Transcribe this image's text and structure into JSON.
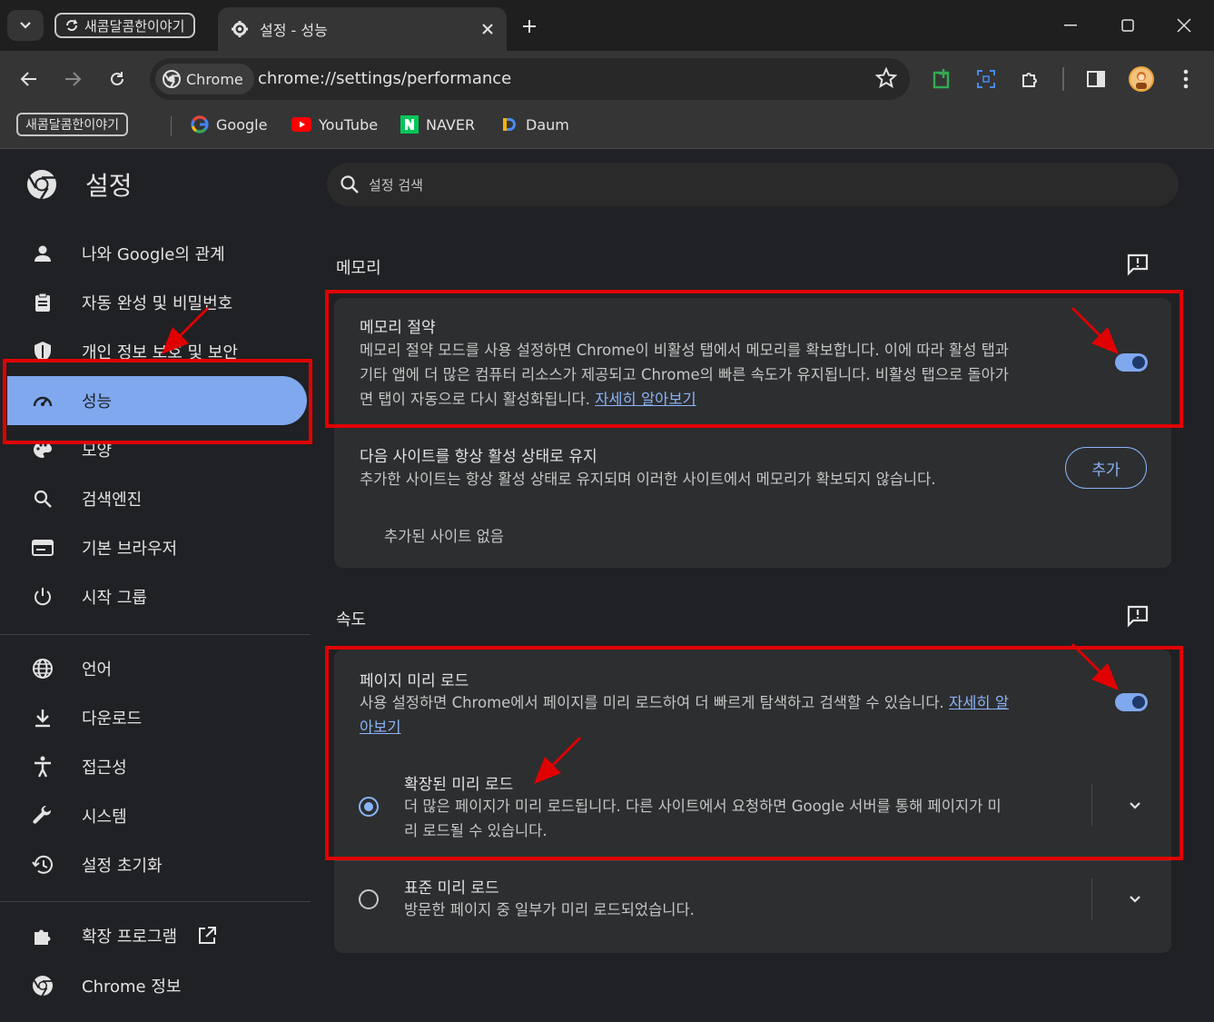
{
  "window": {
    "group_chip": "새콤달콤한이야기",
    "tab_title": "설정 - 성능"
  },
  "toolbar": {
    "chip_label": "Chrome",
    "url": "chrome://settings/performance"
  },
  "bookmarks": {
    "group": "새콤달콤한이야기",
    "items": [
      {
        "label": "Google",
        "icon": "google-icon"
      },
      {
        "label": "YouTube",
        "icon": "youtube-icon"
      },
      {
        "label": "NAVER",
        "icon": "naver-icon"
      },
      {
        "label": "Daum",
        "icon": "daum-icon"
      }
    ]
  },
  "settings": {
    "title": "설정",
    "search_placeholder": "설정 검색",
    "nav": [
      {
        "label": "나와 Google의 관계",
        "icon": "person-icon"
      },
      {
        "label": "자동 완성 및 비밀번호",
        "icon": "clipboard-icon"
      },
      {
        "label": "개인 정보 보호 및 보안",
        "icon": "shield-icon"
      },
      {
        "label": "성능",
        "icon": "speedometer-icon"
      },
      {
        "label": "모양",
        "icon": "palette-icon"
      },
      {
        "label": "검색엔진",
        "icon": "search-icon"
      },
      {
        "label": "기본 브라우저",
        "icon": "browser-icon"
      },
      {
        "label": "시작 그룹",
        "icon": "power-icon"
      },
      {
        "label": "언어",
        "icon": "globe-icon"
      },
      {
        "label": "다운로드",
        "icon": "download-icon"
      },
      {
        "label": "접근성",
        "icon": "accessibility-icon"
      },
      {
        "label": "시스템",
        "icon": "wrench-icon"
      },
      {
        "label": "설정 초기화",
        "icon": "history-icon"
      },
      {
        "label": "확장 프로그램",
        "icon": "puzzle-icon"
      },
      {
        "label": "Chrome 정보",
        "icon": "chrome-icon"
      }
    ]
  },
  "memory": {
    "section_title": "메모리",
    "saver_title": "메모리 절약",
    "saver_desc_1": "메모리 절약 모드를 사용 설정하면 Chrome이 비활성 탭에서 메모리를 확보합니다. 이에 따라 활성 탭과",
    "saver_desc_2": "기타 앱에 더 많은 컴퓨터 리소스가 제공되고 Chrome의 빠른 속도가 유지됩니다. 비활성 탭으로 돌아가",
    "saver_desc_3": "면 탭이 자동으로 다시 활성화됩니다.",
    "saver_link": "자세히 알아보기",
    "saver_enabled": true,
    "keep_title": "다음 사이트를 항상 활성 상태로 유지",
    "keep_desc": "추가한 사이트는 항상 활성 상태로 유지되며 이러한 사이트에서 메모리가 확보되지 않습니다.",
    "add_button": "추가",
    "no_sites": "추가된 사이트 없음"
  },
  "speed": {
    "section_title": "속도",
    "preload_title": "페이지 미리 로드",
    "preload_desc": "사용 설정하면 Chrome에서 페이지를 미리 로드하여 더 빠르게 탐색하고 검색할 수 있습니다.",
    "preload_link_1": "자세히 알",
    "preload_link_2": "아보기",
    "preload_enabled": true,
    "extended_title": "확장된 미리 로드",
    "extended_desc_1": "더 많은 페이지가 미리 로드됩니다. 다른 사이트에서 요청하면 Google 서버를 통해 페이지가 미",
    "extended_desc_2": "리 로드될 수 있습니다.",
    "standard_title": "표준 미리 로드",
    "standard_desc": "방문한 페이지 중 일부가 미리 로드되었습니다.",
    "selected": "확장된 미리 로드"
  },
  "colors": {
    "accent": "#8ab4f8",
    "selected_nav": "#7fa8ef",
    "annotation_red": "#e00000"
  }
}
